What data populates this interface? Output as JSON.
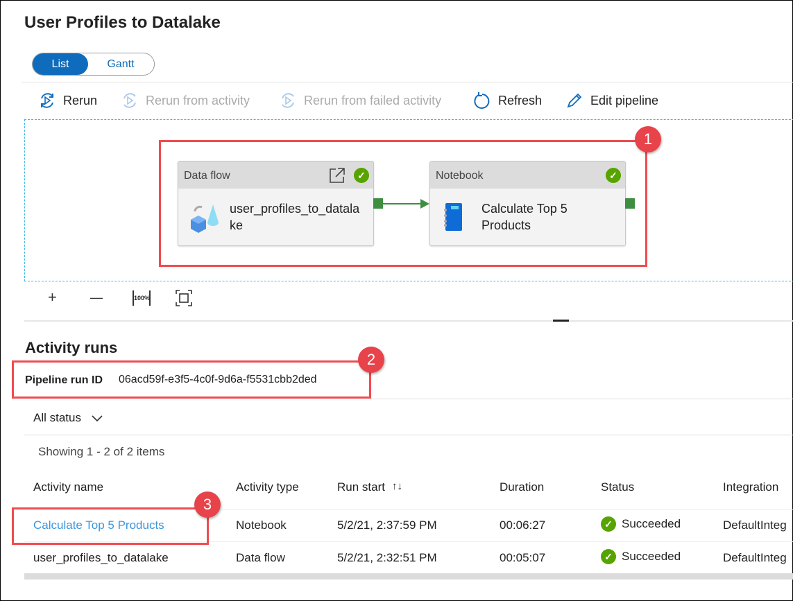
{
  "header": {
    "title": "User Profiles to Datalake"
  },
  "view_toggle": {
    "list": "List",
    "gantt": "Gantt",
    "selected": "List"
  },
  "toolbar": {
    "rerun": "Rerun",
    "rerun_from_activity": "Rerun from activity",
    "rerun_from_failed": "Rerun from failed activity",
    "refresh": "Refresh",
    "edit_pipeline": "Edit pipeline"
  },
  "canvas": {
    "activities": [
      {
        "type": "Data flow",
        "name_line1": "user_profiles_to_datala",
        "name_line2": "ke",
        "status": "succeeded"
      },
      {
        "type": "Notebook",
        "name_line1": "Calculate Top 5",
        "name_line2": "Products",
        "status": "succeeded"
      }
    ],
    "zoom_controls": {
      "zoom_in": "+",
      "zoom_out": "—",
      "reset": "100%"
    }
  },
  "callouts": [
    "1",
    "2",
    "3"
  ],
  "activity_runs": {
    "title": "Activity runs",
    "pipeline_run_id_label": "Pipeline run ID",
    "pipeline_run_id": "06acd59f-e3f5-4c0f-9d6a-f5531cbb2ded",
    "filter": "All status",
    "showing": "Showing 1 - 2 of 2 items",
    "columns": [
      "Activity name",
      "Activity type",
      "Run start",
      "Duration",
      "Status",
      "Integration"
    ],
    "rows": [
      {
        "name": "Calculate Top 5 Products",
        "type": "Notebook",
        "start": "5/2/21, 2:37:59 PM",
        "duration": "00:06:27",
        "status": "Succeeded",
        "integration": "DefaultInteg"
      },
      {
        "name": "user_profiles_to_datalake",
        "type": "Data flow",
        "start": "5/2/21, 2:32:51 PM",
        "duration": "00:05:07",
        "status": "Succeeded",
        "integration": "DefaultInteg"
      }
    ]
  },
  "colors": {
    "accent": "#0f6cbd",
    "success": "#57a300",
    "callout": "#e8434a",
    "link": "#3a96dd"
  }
}
